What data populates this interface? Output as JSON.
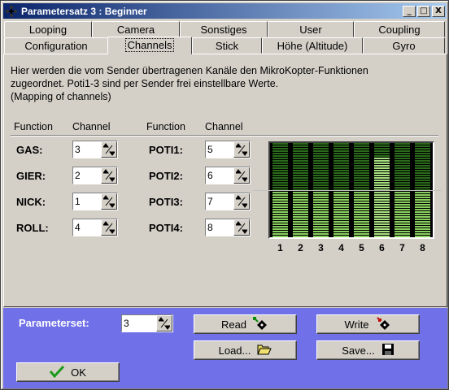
{
  "window": {
    "title": "Parametersatz 3 : Beginner"
  },
  "title_buttons": {
    "minimize": "_",
    "maximize": "□",
    "close": "X"
  },
  "tabs_row1": [
    "Looping",
    "Camera",
    "Sonstiges",
    "User",
    "Coupling"
  ],
  "tabs_row2": [
    "Configuration",
    "Channels",
    "Stick",
    "Höhe (Altitude)",
    "Gyro"
  ],
  "active_tab": "Channels",
  "description": [
    "Hier werden die vom Sender übertragenen Kanäle den MikroKopter-Funktionen",
    "zugeordnet. Poti1-3 sind per Sender frei einstellbare Werte.",
    "(Mapping of channels)"
  ],
  "headers": {
    "function": "Function",
    "channel": "Channel"
  },
  "left_functions": [
    {
      "label": "GAS:",
      "value": "3"
    },
    {
      "label": "GIER:",
      "value": "2"
    },
    {
      "label": "NICK:",
      "value": "1"
    },
    {
      "label": "ROLL:",
      "value": "4"
    }
  ],
  "right_functions": [
    {
      "label": "POTI1:",
      "value": "5"
    },
    {
      "label": "POTI2:",
      "value": "6"
    },
    {
      "label": "POTI3:",
      "value": "7"
    },
    {
      "label": "POTI4:",
      "value": "8"
    }
  ],
  "meter": {
    "channels": [
      "1",
      "2",
      "3",
      "4",
      "5",
      "6",
      "7",
      "8"
    ],
    "levels": [
      0.5,
      0.5,
      0.5,
      0.5,
      0.5,
      0.85,
      0.5,
      0.5
    ],
    "colors": {
      "lit": "#8ad060",
      "dim": "#2a6a1a",
      "peak": "#a8e080"
    }
  },
  "bottom": {
    "parameterset_label": "Parameterset:",
    "parameterset_value": "3",
    "read": "Read",
    "write": "Write",
    "load": "Load...",
    "save": "Save...",
    "ok": "OK"
  },
  "accent": "#7070e8"
}
